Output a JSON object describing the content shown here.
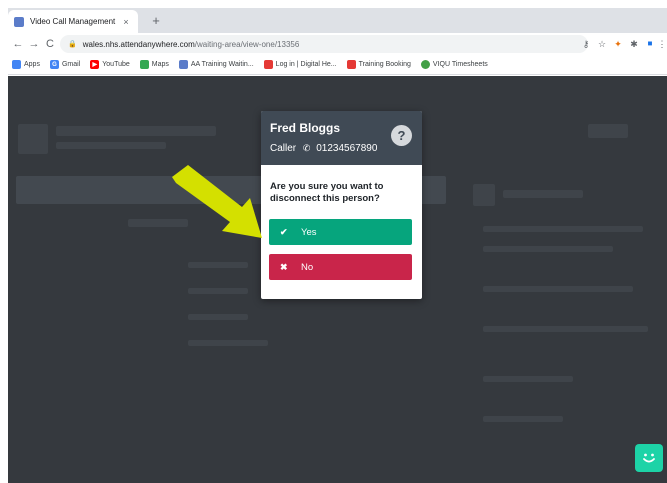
{
  "browser": {
    "tab_title": "Video Call Management",
    "tab_close": "×",
    "new_tab": "+",
    "url_host": "wales.nhs.attendanywhere.com",
    "url_path": "/waiting-area/view-one/13356",
    "nav": {
      "back": "←",
      "forward": "→",
      "reload": "C"
    }
  },
  "bookmarks": [
    {
      "label": "Apps",
      "icon": "apps-icon",
      "color": "#4285f4"
    },
    {
      "label": "Gmail",
      "icon": "google-icon",
      "color": "#4285f4"
    },
    {
      "label": "YouTube",
      "icon": "youtube-icon",
      "color": "#ff0000"
    },
    {
      "label": "Maps",
      "icon": "maps-icon",
      "color": "#34a853"
    },
    {
      "label": "AA Training Waitin...",
      "icon": "page-icon",
      "color": "#5b7cc9"
    },
    {
      "label": "Log in | Digital He...",
      "icon": "nhs-icon",
      "color": "#e53935"
    },
    {
      "label": "Training Booking",
      "icon": "nhs-icon",
      "color": "#e53935"
    },
    {
      "label": "VIQU Timesheets",
      "icon": "viqu-icon",
      "color": "#43a047"
    }
  ],
  "modal": {
    "caller_name": "Fred Bloggs",
    "caller_role": "Caller",
    "caller_phone": "01234567890",
    "help_glyph": "?",
    "question": "Are you sure you want to disconnect this person?",
    "yes_label": "Yes",
    "no_label": "No"
  },
  "colors": {
    "header": "#404a55",
    "yes": "#06a57d",
    "no": "#c9254a",
    "arrow": "#d4e000",
    "chat": "#1dd3a7"
  }
}
